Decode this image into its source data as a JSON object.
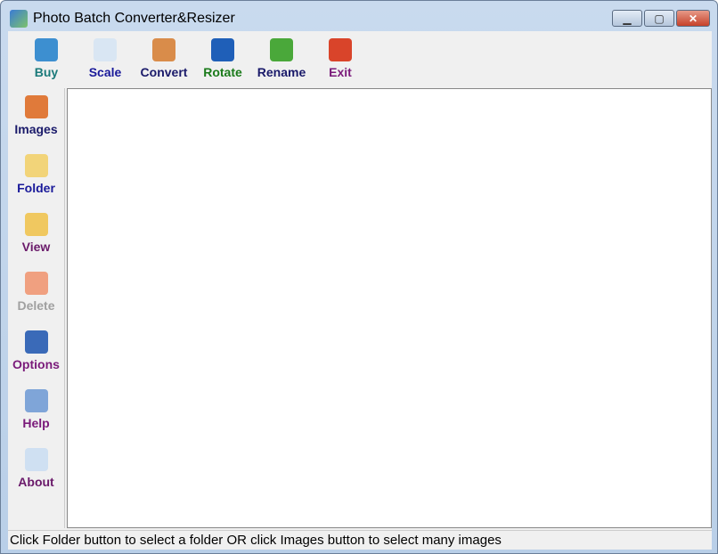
{
  "window": {
    "title": "Photo Batch Converter&Resizer"
  },
  "toolbar": [
    {
      "label": "Buy",
      "color": "#1a7a7a",
      "icon": "globe-hand-icon"
    },
    {
      "label": "Scale",
      "color": "#1a1a9a",
      "icon": "zoom-icon"
    },
    {
      "label": "Convert",
      "color": "#1a1a6a",
      "icon": "convert-icon"
    },
    {
      "label": "Rotate",
      "color": "#1a7a1a",
      "icon": "rotate-icon"
    },
    {
      "label": "Rename",
      "color": "#1a1a6a",
      "icon": "rename-icon"
    },
    {
      "label": "Exit",
      "color": "#7a1a7a",
      "icon": "power-icon"
    }
  ],
  "sidebar": [
    {
      "label": "Images",
      "color": "#1a1a6a",
      "icon": "picture-icon"
    },
    {
      "label": "Folder",
      "color": "#1a1a9a",
      "icon": "folder-icon"
    },
    {
      "label": "View",
      "color": "#6a1a6a",
      "icon": "view-icon"
    },
    {
      "label": "Delete",
      "color": "#a0a0a0",
      "icon": "delete-icon"
    },
    {
      "label": "Options",
      "color": "#7a1a7a",
      "icon": "options-icon"
    },
    {
      "label": "Help",
      "color": "#7a1a7a",
      "icon": "help-icon"
    },
    {
      "label": "About",
      "color": "#6a1a6a",
      "icon": "envelope-icon"
    }
  ],
  "status": "Click Folder button to select a folder OR click Images button to select many images"
}
